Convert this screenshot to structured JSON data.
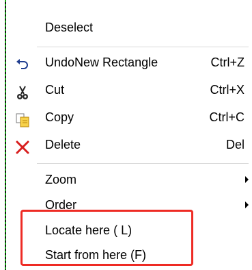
{
  "menu": {
    "items": [
      {
        "label": "Deselect",
        "shortcut": "",
        "icon": null,
        "submenu": false
      },
      {
        "label": "UndoNew Rectangle",
        "shortcut": "Ctrl+Z",
        "icon": "undo-icon",
        "submenu": false
      },
      {
        "label": "Cut",
        "shortcut": "Ctrl+X",
        "icon": "scissors-icon",
        "submenu": false
      },
      {
        "label": "Copy",
        "shortcut": "Ctrl+C",
        "icon": "copy-icon",
        "submenu": false
      },
      {
        "label": "Delete",
        "shortcut": "Del",
        "icon": "delete-x-icon",
        "submenu": false
      },
      {
        "label": "Zoom",
        "shortcut": "",
        "icon": null,
        "submenu": true
      },
      {
        "label": "Order",
        "shortcut": "",
        "icon": null,
        "submenu": true
      },
      {
        "label": "Locate here ( L)",
        "shortcut": "",
        "icon": null,
        "submenu": false
      },
      {
        "label": "Start from here (F)",
        "shortcut": "",
        "icon": null,
        "submenu": false
      }
    ]
  },
  "colors": {
    "highlight_border": "#ee2b24",
    "canvas_selection_dash": "#1aa91a",
    "delete_icon": "#d81e1e"
  }
}
